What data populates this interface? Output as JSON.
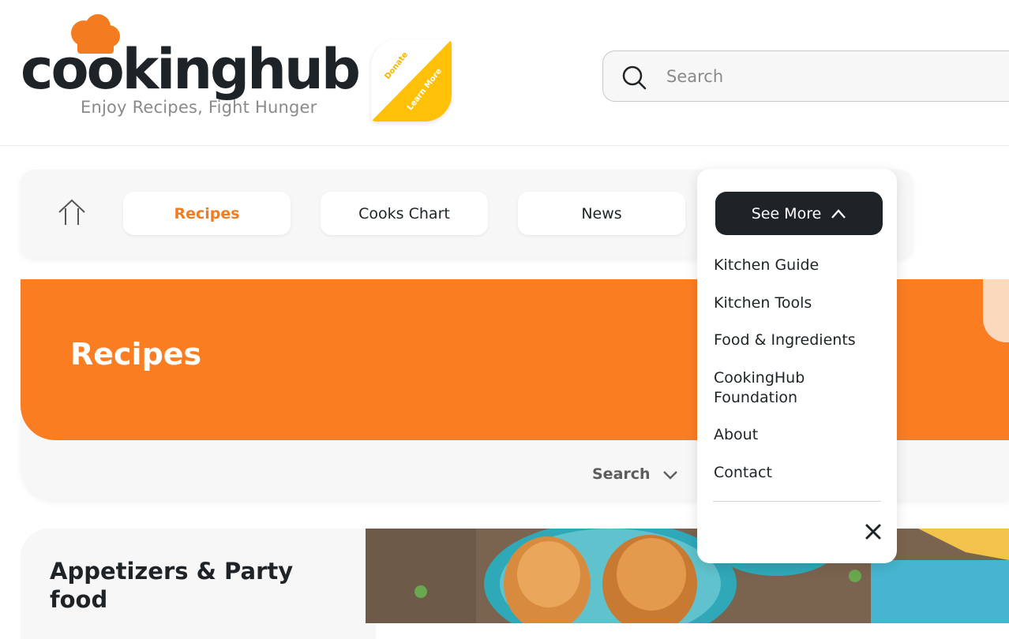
{
  "header": {
    "logo_text": "cookinghub",
    "tagline": "Enjoy Recipes, Fight Hunger",
    "donate_badge": {
      "line1": "Donate",
      "line2": "Learn More"
    },
    "search": {
      "placeholder": "Search"
    }
  },
  "nav": {
    "home_icon": "home-icon",
    "items": [
      {
        "label": "Recipes",
        "active": true
      },
      {
        "label": "Cooks Chart",
        "active": false
      },
      {
        "label": "News",
        "active": false
      }
    ],
    "see_more_label": "See More"
  },
  "dropdown": {
    "items": [
      "Kitchen Guide",
      "Kitchen Tools",
      "Food & Ingredients",
      "CookingHub Foundation",
      "About",
      "Contact"
    ],
    "close_icon": "close-icon"
  },
  "hero": {
    "title": "Recipes"
  },
  "filter": {
    "label": "Search"
  },
  "card": {
    "title": "Appetizers & Party food"
  },
  "colors": {
    "brand_orange": "#fb7d22",
    "dark": "#1d2327",
    "donate_yellow": "#ffc107"
  }
}
